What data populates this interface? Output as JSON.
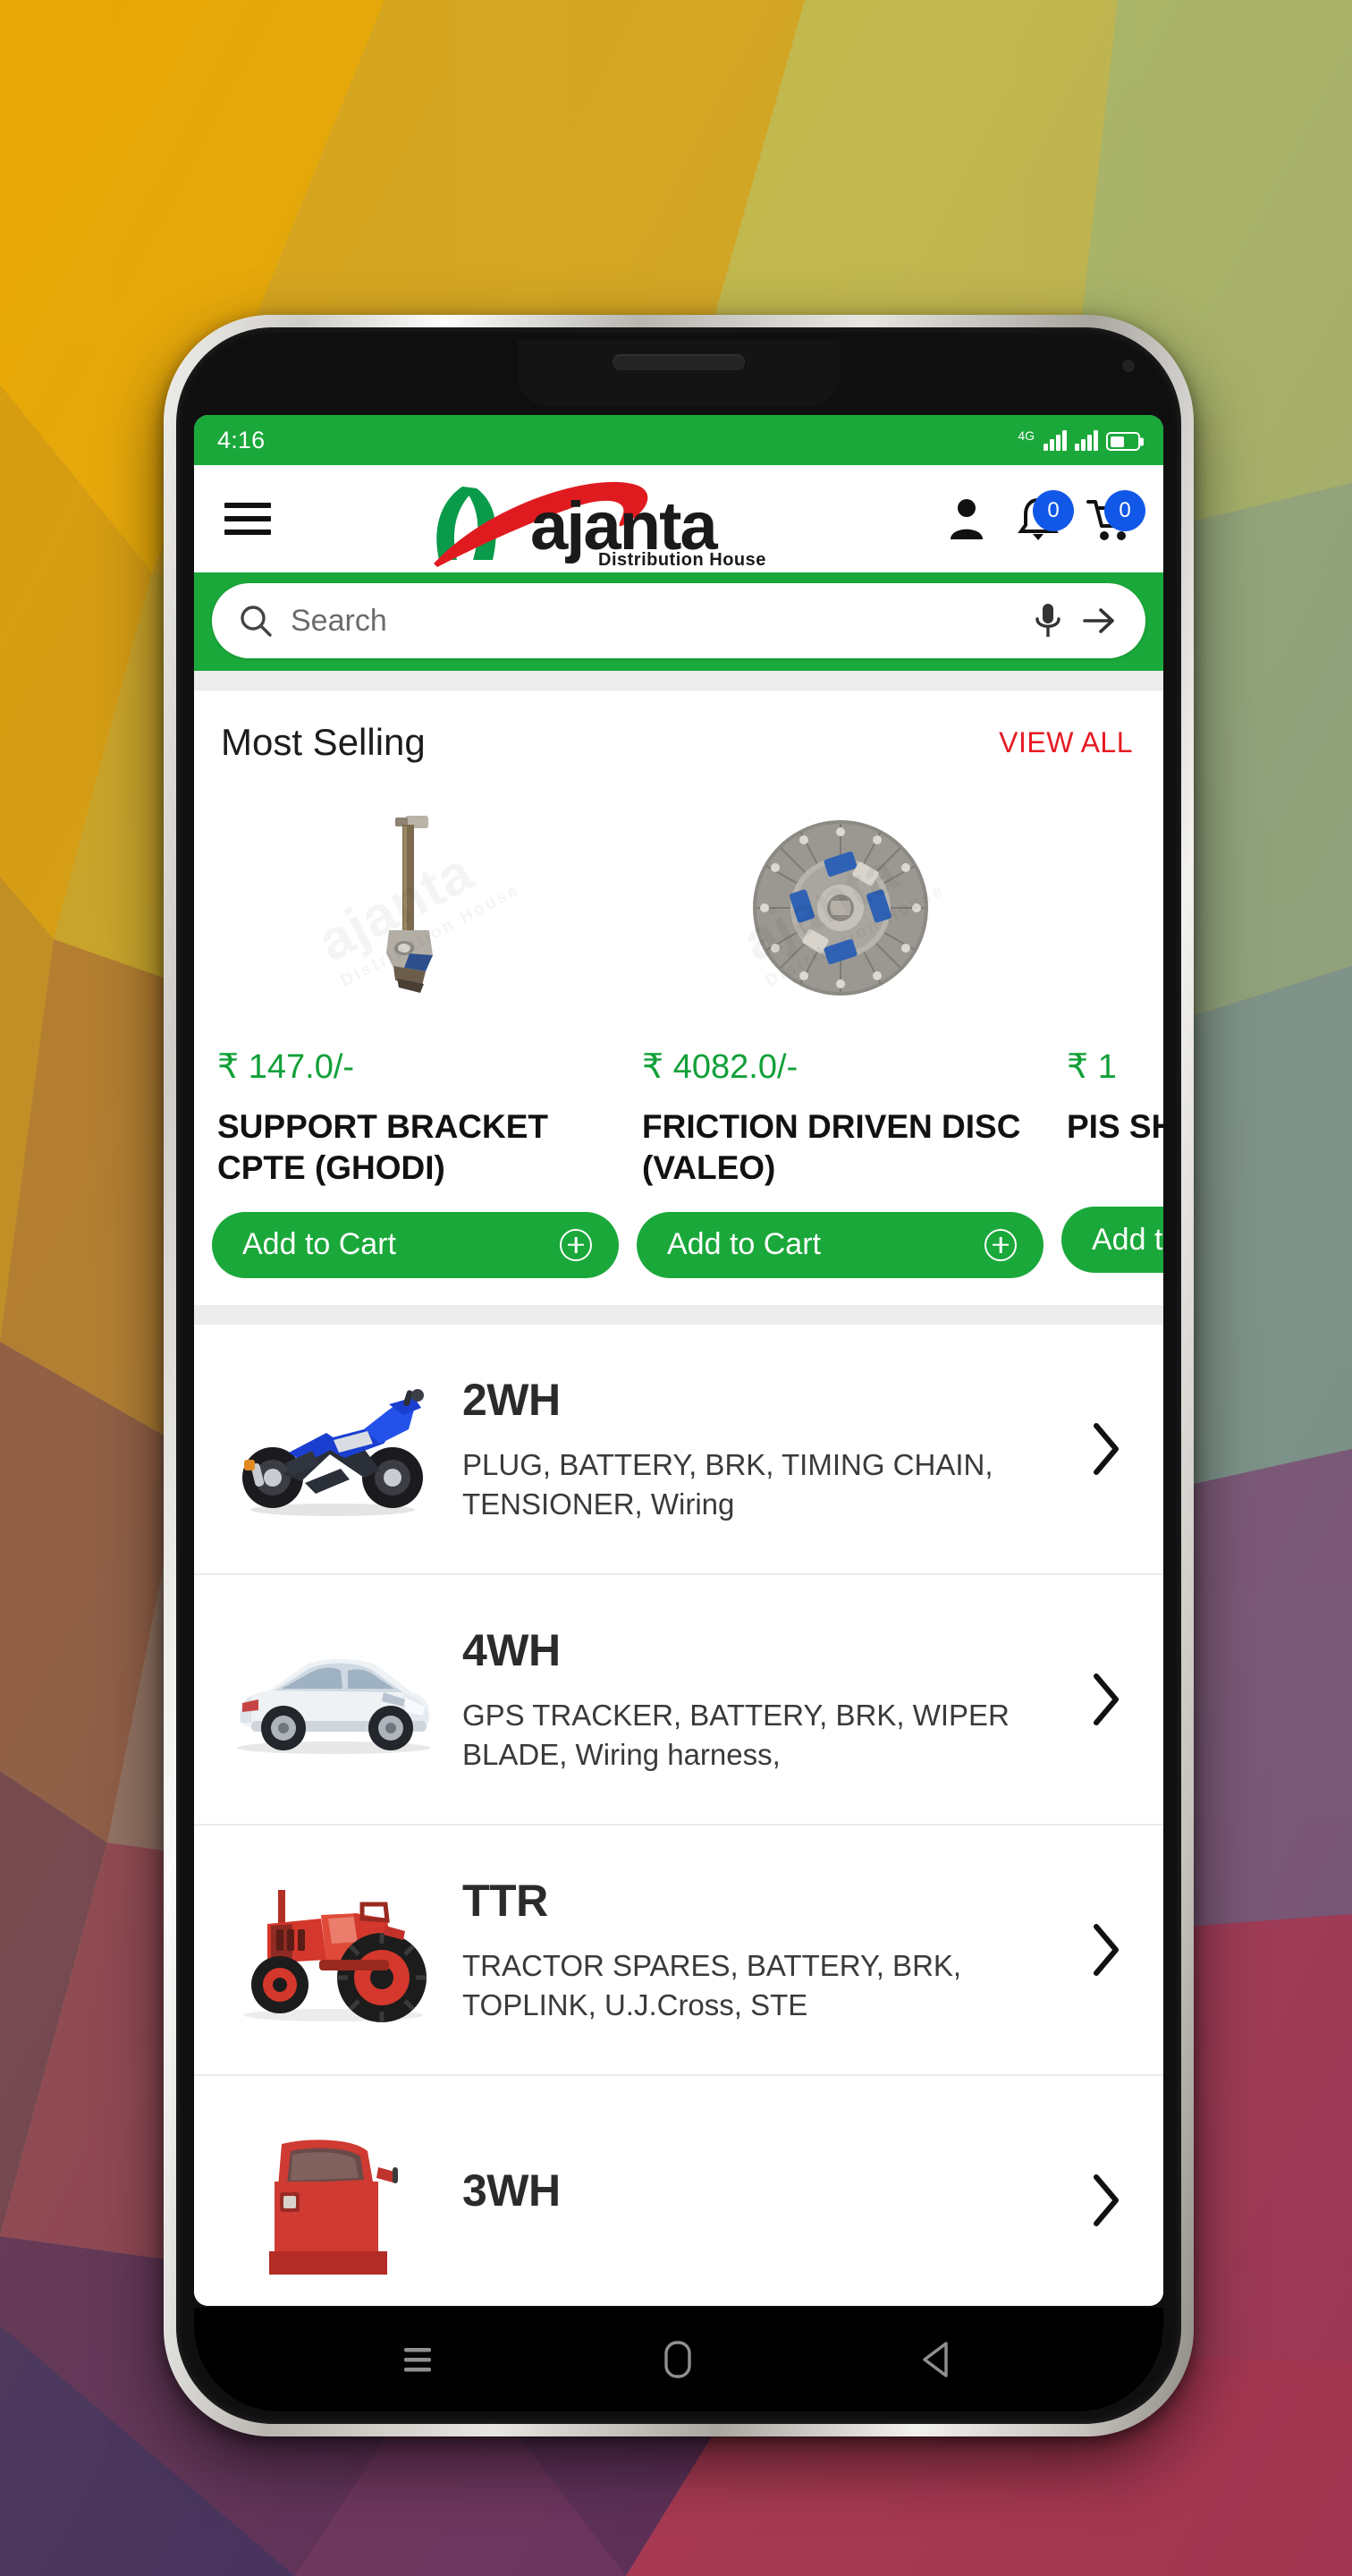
{
  "wallpaper": {
    "description": "low-poly triangular gradient wallpaper",
    "colors": [
      "#e8a808",
      "#d9a51c",
      "#c9bd4a",
      "#a8bb6a",
      "#8fae7e",
      "#7a9d8c",
      "#6c4f6e",
      "#8a3a5e",
      "#b23a4e",
      "#c0395a",
      "#5b2a58",
      "#3f2a55"
    ]
  },
  "status_bar": {
    "time": "4:16",
    "network_label": "4G",
    "icons": [
      "signal-bars-icon",
      "signal-bars-icon",
      "battery-icon"
    ]
  },
  "app_bar": {
    "menu_icon": "hamburger-menu-icon",
    "logo": {
      "wordmark": "ajanta",
      "tagline": "Distribution House"
    },
    "account_icon": "person-icon",
    "notifications": {
      "icon": "bell-icon",
      "badge": "0"
    },
    "cart": {
      "icon": "shopping-cart-icon",
      "badge": "0"
    }
  },
  "search": {
    "placeholder": "Search",
    "value": "",
    "search_icon": "magnifier-icon",
    "mic_icon": "microphone-icon",
    "submit_icon": "arrow-right-icon"
  },
  "most_selling": {
    "title": "Most Selling",
    "view_all_label": "VIEW ALL",
    "add_to_cart_label": "Add to Cart",
    "products": [
      {
        "price": "₹ 147.0/-",
        "name": "SUPPORT BRACKET CPTE (GHODI)",
        "image": "support-bracket-part-photo",
        "add_to_cart_label": "Add to Cart"
      },
      {
        "price": "₹ 4082.0/-",
        "name": "FRICTION DRIVEN DISC (VALEO)",
        "image": "clutch-friction-disc-photo",
        "add_to_cart_label": "Add to Cart"
      },
      {
        "price": "₹ 1",
        "name": "PIS SHT",
        "image": "piston-part-photo",
        "add_to_cart_label": "Add to Cart"
      }
    ],
    "watermark_text": "ajanta",
    "watermark_sub": "Distribution House"
  },
  "categories": [
    {
      "title": "2WH",
      "description": "PLUG, BATTERY, BRK, TIMING CHAIN, TENSIONER, Wiring",
      "image": "motorcycle-photo",
      "chevron": "chevron-right-icon"
    },
    {
      "title": "4WH",
      "description": "GPS TRACKER, BATTERY, BRK, WIPER  BLADE, Wiring harness,",
      "image": "car-photo",
      "chevron": "chevron-right-icon"
    },
    {
      "title": "TTR",
      "description": "TRACTOR SPARES, BATTERY, BRK, TOPLINK, U.J.Cross, STE",
      "image": "tractor-photo",
      "chevron": "chevron-right-icon"
    },
    {
      "title": "3WH",
      "description": "",
      "image": "three-wheeler-photo",
      "chevron": "chevron-right-icon"
    }
  ],
  "android_nav": {
    "recents_icon": "recents-icon",
    "home_icon": "home-icon",
    "back_icon": "back-icon"
  },
  "theme": {
    "brand_green": "#1aa83a",
    "price_green": "#12a038",
    "accent_red": "#e61b23",
    "badge_blue": "#1158e8"
  }
}
